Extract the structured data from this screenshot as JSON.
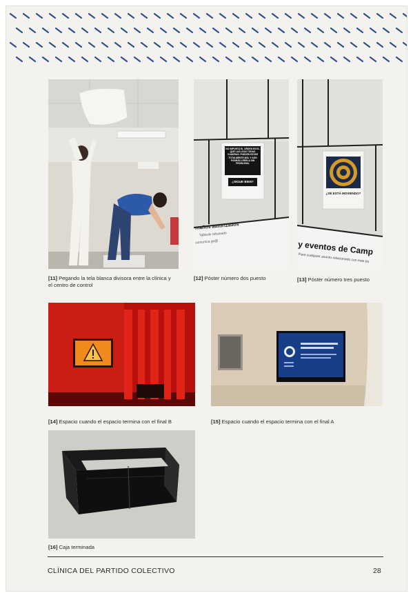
{
  "document": {
    "accent_color": "#2d4f8a",
    "page_background": "#f3f2ee"
  },
  "figures": [
    {
      "number": "[11]",
      "caption": "Pegando la tela blanca divisora entre la clínica y el centro de control",
      "image": "photo-person-hanging-white-fabric"
    },
    {
      "number": "[12]",
      "caption": "Póster número dos puesto",
      "image": "photo-poster-two-on-wall",
      "poster_text": "NO IMPORTA EL ORDEN EN EL QUE LAS LEAS TODAS CUADRAN. PUEDEN ESTAR TOTALMENTE MAL Y AÚN PODRÁS LEERLA SIN PROBLEMA.",
      "poster_heading": "¿SIGUE BIEN?",
      "wall_text_1": "maños autorizados",
      "wall_text_2": "Tablede rebasado",
      "wall_text_3": "comunica go@"
    },
    {
      "number": "[13]",
      "caption": "Póster número tres puesto",
      "image": "photo-poster-three-on-wall",
      "poster_heading": "¿SE ESTÁ MOVIENDO?",
      "wall_text_1": "y eventos de Camp",
      "wall_text_2": "Para cualquier asunto relacionado con este pu"
    },
    {
      "number": "[14]",
      "caption": "Espacio cuando el espacio termina con el final B",
      "image": "photo-red-room-warning-screen"
    },
    {
      "number": "[15]",
      "caption": "Espacio cuando el espacio termina con el final A",
      "image": "photo-blue-screen-room"
    },
    {
      "number": "[16]",
      "caption": "Caja terminada",
      "image": "photo-black-box"
    }
  ],
  "footer": {
    "title": "CLÍNICA DEL PARTIDO COLECTIVO",
    "page_number": "28"
  }
}
